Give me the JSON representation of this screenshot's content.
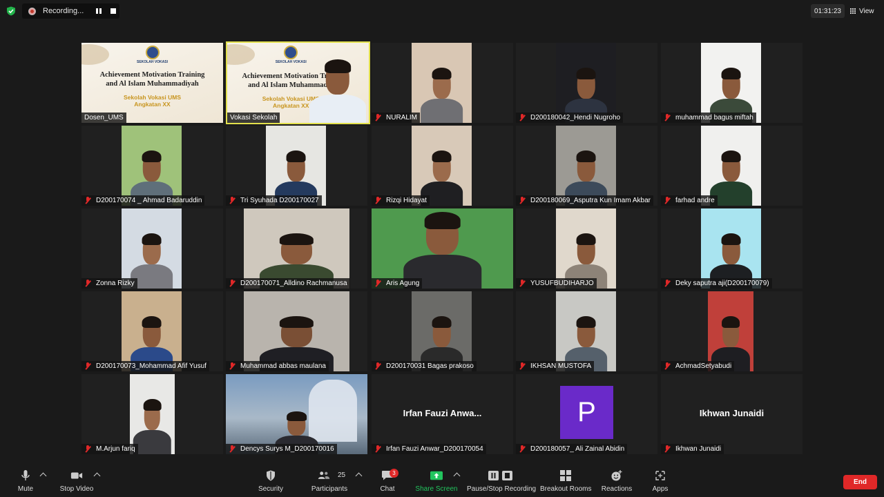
{
  "topbar": {
    "recording_label": "Recording...",
    "timer": "01:31:23",
    "view_label": "View"
  },
  "slide": {
    "school_header": "SEKOLAH VOKASI",
    "title_line1": "Achievement Motivation Training",
    "title_line2": "and Al Islam Muhammadiyah",
    "school_line1": "Sekolah Vokasi UMS",
    "school_line2": "Angkatan XX"
  },
  "participants": [
    {
      "name": "Dosen_UMS",
      "muted": false
    },
    {
      "name": "Vokasi Sekolah",
      "muted": false
    },
    {
      "name": "NURALIM",
      "muted": true
    },
    {
      "name": "D200180042_Hendi Nugroho",
      "muted": true
    },
    {
      "name": "muhammad bagus miftah",
      "muted": true
    },
    {
      "name": "D200170074 _ Ahmad Badaruddin",
      "muted": true
    },
    {
      "name": "Tri Syuhada D200170027",
      "muted": true
    },
    {
      "name": "Rizqi Hidayat",
      "muted": true
    },
    {
      "name": "D200180069_Asputra Kun Imam Akbar",
      "muted": true
    },
    {
      "name": "farhad andre",
      "muted": true
    },
    {
      "name": "Zonna Rizky",
      "muted": true
    },
    {
      "name": "D200170071_Alldino Rachmanusa",
      "muted": true
    },
    {
      "name": "Aris Agung",
      "muted": true
    },
    {
      "name": "YUSUFBUDIHARJO",
      "muted": true
    },
    {
      "name": "Deky saputra aji(D200170079)",
      "muted": true
    },
    {
      "name": "D200170073_Mohammad Afif Yusuf",
      "muted": true
    },
    {
      "name": "Muhammad abbas maulana",
      "muted": true
    },
    {
      "name": "D200170031 Bagas prakoso",
      "muted": true
    },
    {
      "name": "IKHSAN MUSTOFA",
      "muted": true
    },
    {
      "name": "AchmadSetyabudi",
      "muted": true
    },
    {
      "name": "M.Arjun fariq",
      "muted": true
    },
    {
      "name": "Dencys Surys M_D200170016",
      "muted": true
    },
    {
      "name": "Irfan Fauzi Anwar_D200170054",
      "muted": true,
      "display": "Irfan Fauzi Anwa..."
    },
    {
      "name": "D200180057_ Ali Zainal Abidin",
      "muted": true,
      "avatar": "P"
    },
    {
      "name": "Ikhwan Junaidi",
      "muted": true,
      "display": "Ikhwan Junaidi"
    }
  ],
  "toolbar": {
    "mute": "Mute",
    "stop_video": "Stop Video",
    "security": "Security",
    "participants": "Participants",
    "participant_count": "25",
    "chat": "Chat",
    "chat_badge": "3",
    "share_screen": "Share Screen",
    "pause_stop_recording": "Pause/Stop Recording",
    "breakout_rooms": "Breakout Rooms",
    "reactions": "Reactions",
    "apps": "Apps",
    "end": "End"
  },
  "colors": {
    "active_speaker_border": "#e2e04c",
    "share_green": "#22c55e",
    "end_red": "#e02828",
    "avatar_purple": "#6a2ac9"
  }
}
